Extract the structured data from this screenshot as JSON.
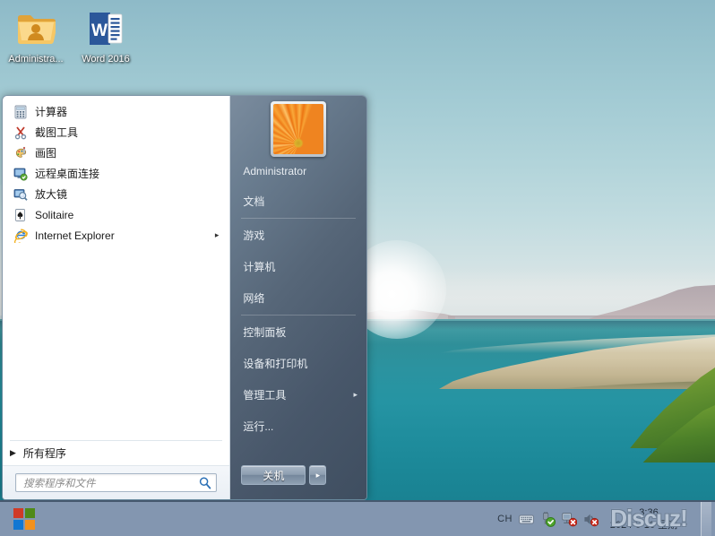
{
  "desktop": {
    "icons": [
      {
        "name": "administrator-folder",
        "label": "Administra...",
        "icon": "user-folder-icon"
      },
      {
        "name": "word-2016",
        "label": "Word 2016",
        "icon": "word-icon"
      }
    ]
  },
  "start_menu": {
    "programs": [
      {
        "label": "计算器",
        "icon": "calculator-icon",
        "submenu": false
      },
      {
        "label": "截图工具",
        "icon": "snipping-tool-icon",
        "submenu": false
      },
      {
        "label": "画图",
        "icon": "paint-icon",
        "submenu": false
      },
      {
        "label": "远程桌面连接",
        "icon": "remote-desktop-icon",
        "submenu": false
      },
      {
        "label": "放大镜",
        "icon": "magnifier-icon",
        "submenu": false
      },
      {
        "label": "Solitaire",
        "icon": "solitaire-icon",
        "submenu": false
      },
      {
        "label": "Internet Explorer",
        "icon": "internet-explorer-icon",
        "submenu": true
      }
    ],
    "all_programs_label": "所有程序",
    "search_placeholder": "搜索程序和文件",
    "search_value": "",
    "user_name": "Administrator",
    "user_picture": "orange-daisy-flower",
    "right_items": [
      {
        "label": "文档",
        "submenu": false,
        "sep_after": true
      },
      {
        "label": "游戏",
        "submenu": false,
        "sep_after": false
      },
      {
        "label": "计算机",
        "submenu": false,
        "sep_after": false
      },
      {
        "label": "网络",
        "submenu": false,
        "sep_after": true
      },
      {
        "label": "控制面板",
        "submenu": false,
        "sep_after": false
      },
      {
        "label": "设备和打印机",
        "submenu": false,
        "sep_after": false
      },
      {
        "label": "管理工具",
        "submenu": true,
        "sep_after": false
      },
      {
        "label": "运行...",
        "submenu": false,
        "sep_after": false
      }
    ],
    "shutdown_label": "关机",
    "shutdown_arrow": "▸",
    "submenu_arrow": "▸",
    "all_programs_arrow": "▶"
  },
  "taskbar": {
    "start_button": "windows-logo-icon",
    "tray": {
      "language_indicator": "CH",
      "items": [
        {
          "name": "keyboard-icon"
        },
        {
          "name": "safely-remove-hardware-icon"
        },
        {
          "name": "network-disconnected-icon"
        },
        {
          "name": "volume-muted-icon"
        }
      ]
    },
    "clock": {
      "time": "3:36",
      "date": "2024-6-10 星期一"
    },
    "watermark": "Discuz!"
  },
  "colors": {
    "taskbar": "#8396b0",
    "taskbar_border": "#46586e",
    "menu_right_panel": "#566678",
    "accent_blue": "#1f7bd4",
    "water": "#2594a3",
    "sky": "#a3cbd4",
    "grass": "#6f9a33",
    "reeds": "#d2c6a6",
    "win_logo_red": "#d03a26",
    "win_logo_green": "#4f8a18",
    "win_logo_blue": "#1277d3",
    "win_logo_orange": "#f3911c"
  }
}
